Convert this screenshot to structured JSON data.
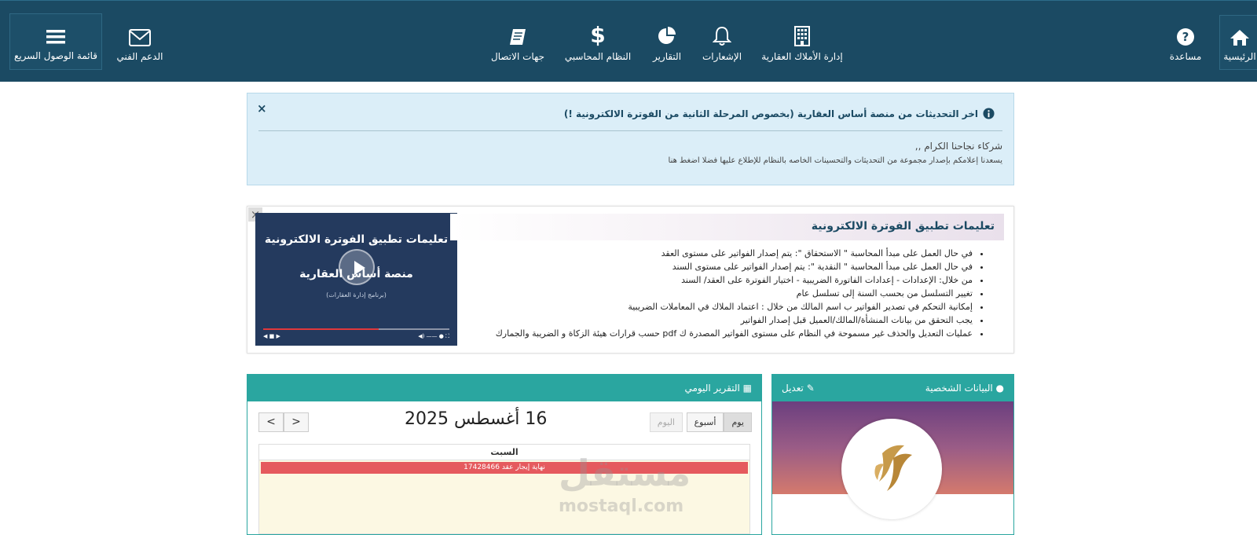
{
  "nav": {
    "home": "الرئيسية",
    "help": "مساعدة",
    "property_mgmt": "إدارة الأملاك العقارية",
    "notifications": "الإشعارات",
    "reports": "التقارير",
    "accounting": "النظام المحاسبي",
    "contacts": "جهات الاتصال",
    "support": "الدعم الفني",
    "quick_menu": "قائمة الوصول السريع"
  },
  "alert": {
    "title": "اخر التحديثات من منصة أساس العقارية (بخصوص المرحلة الثانية من الفوترة الالكترونية !)",
    "greeting": "شركاء نجاحنا الكرام ,,",
    "body": "يسعدنا إعلامكم بإصدار مجموعة من التحديثات والتحسينات الخاصه بالنظام للإطلاع عليها فضلا اضغط هنا",
    "close": "×"
  },
  "instructions": {
    "title": "تعليمات تطبيق الفوترة الالكترونية",
    "close": "×",
    "items": [
      "في حال العمل على مبدأ المحاسبة \" الاستحقاق \": يتم إصدار الفواتير على مستوى العقد",
      "في حال العمل على مبدأ المحاسبة \" النقدية \": يتم إصدار الفواتير على مستوى السند",
      "من خلال: الإعدادات - إعدادات الفاتورة الضريبية - اختيار الفوترة على العقد/ السند",
      "تغيير التسلسل من بحسب السنة إلى تسلسل عام",
      "إمكانية التحكم في تصدير الفواتير ب اسم المالك من خلال : اعتماد الملاك في المعاملات الضريبية",
      "يجب التحقق من بيانات المنشأة/المالك/العميل قبل إصدار الفواتير",
      "عمليات التعديل والحذف غير مسموحة في النظام على مستوى الفواتير المصدرة ك pdf حسب قرارات هيئة الزكاة و الضريبة والجمارك"
    ],
    "video": {
      "line1": "تعليمات تطبيق الفوترة الالكترونية",
      "line2": "منصة أساس العقارية",
      "line3": "(برنامج إدارة العقارات)"
    }
  },
  "daily": {
    "title": "التقرير اليومي",
    "date_title": "16 أغسطس 2025",
    "today": "اليوم",
    "day": "يوم",
    "week": "أسبوع",
    "prev": "<",
    "next": ">",
    "day_name": "السبت",
    "event": "نهاية إيجار عقد 17428466"
  },
  "profile": {
    "title": "البيانات الشخصية",
    "edit": "تعديل"
  },
  "watermark": {
    "ar": "مستقل",
    "en": "mostaql.com"
  },
  "colors": {
    "topbar": "#1b4a63",
    "teal": "#2aa6a0",
    "alert_bg": "#dbeef8",
    "event": "#e55a5e"
  }
}
